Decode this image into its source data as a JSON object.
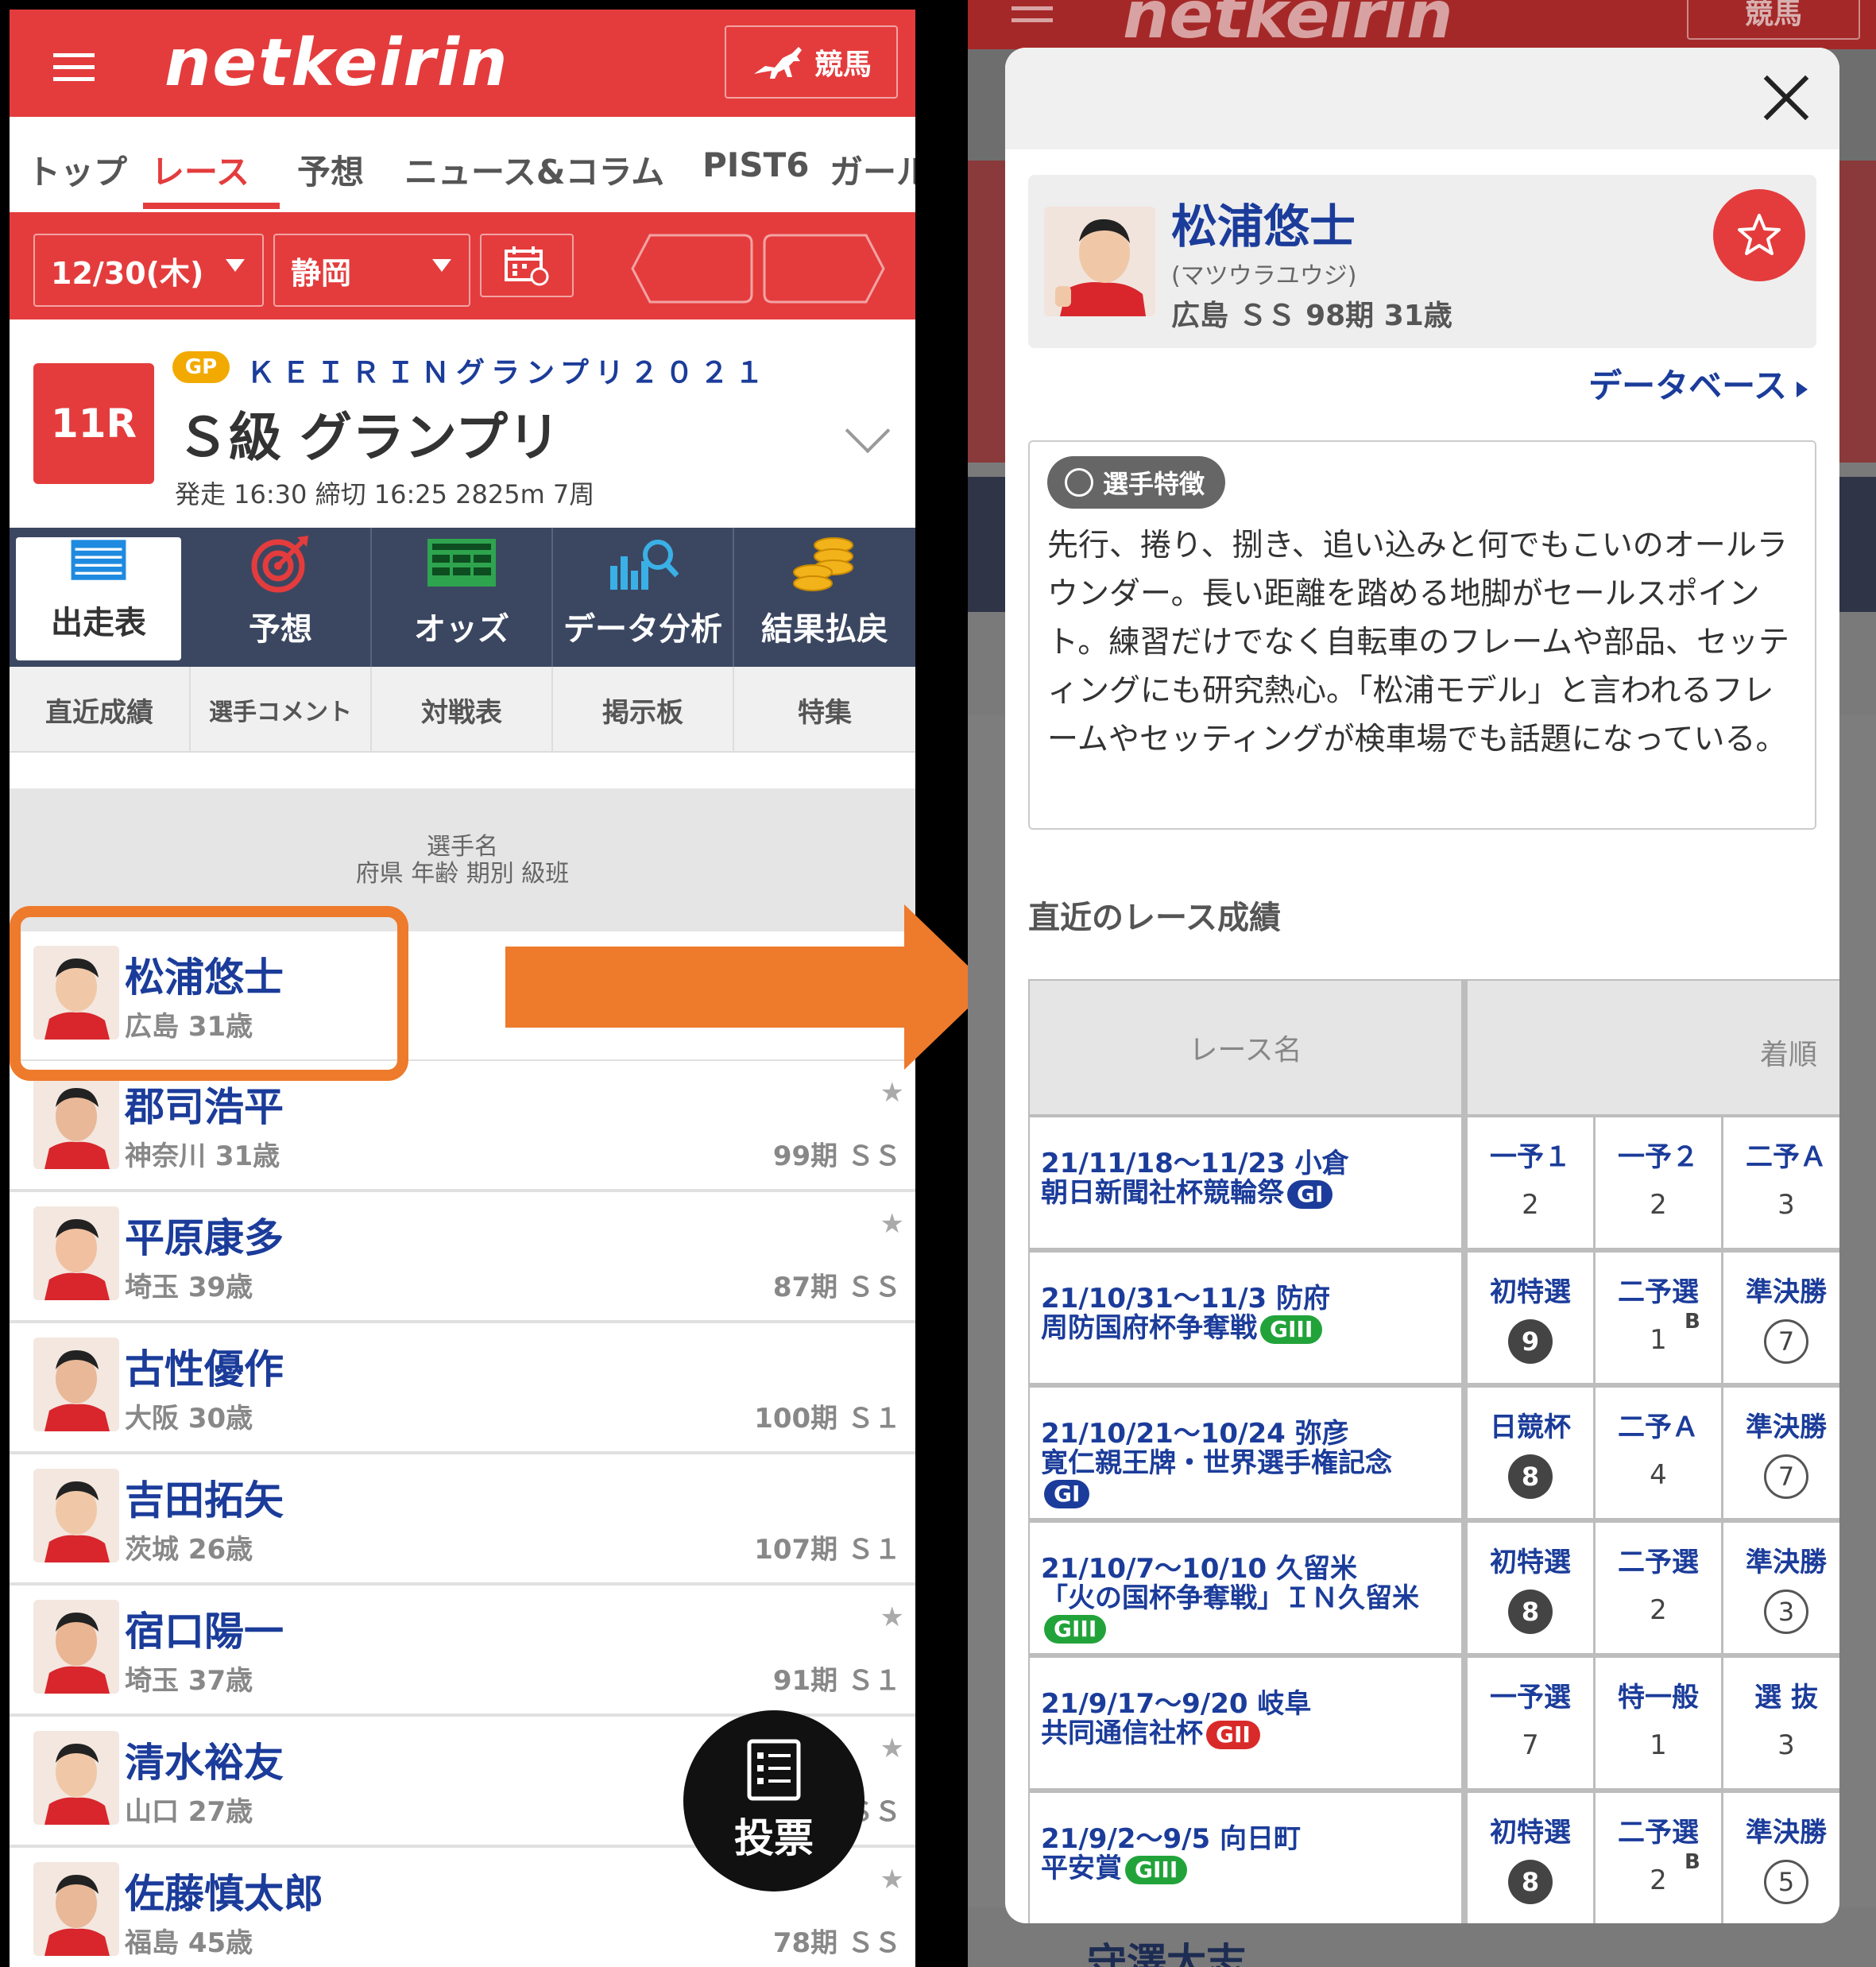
{
  "left": {
    "header": {
      "logo": "netkeirin",
      "keiba_label": "競馬"
    },
    "nav": [
      "トップ",
      "レース",
      "予想",
      "ニュース&コラム",
      "PIST6",
      "ガール"
    ],
    "selectors": {
      "date": "12/30(木)",
      "venue": "静岡"
    },
    "race": {
      "number": "11R",
      "gp_badge": "GP",
      "event_name": "ＫＥＩＲＩＮグランプリ２０２１",
      "title": "Ｓ級 グランプリ",
      "meta": "発走 16:30 締切 16:25 2825m 7周"
    },
    "tabs": [
      "出走表",
      "予想",
      "オッズ",
      "データ分析",
      "結果払戻"
    ],
    "subtabs": [
      "直近成績",
      "選手コメント",
      "対戦表",
      "掲示板",
      "特集"
    ],
    "list_header": {
      "line1": "選手名",
      "line2": "府県 年齢 期別 級班"
    },
    "riders": [
      {
        "name": "松浦悠士",
        "sub": "広島 31歳",
        "cls": "",
        "star": false
      },
      {
        "name": "郡司浩平",
        "sub": "神奈川 31歳",
        "cls": "99期 ＳＳ",
        "star": true
      },
      {
        "name": "平原康多",
        "sub": "埼玉 39歳",
        "cls": "87期 ＳＳ",
        "star": true
      },
      {
        "name": "古性優作",
        "sub": "大阪 30歳",
        "cls": "100期 Ｓ１",
        "star": false
      },
      {
        "name": "吉田拓矢",
        "sub": "茨城 26歳",
        "cls": "107期 Ｓ１",
        "star": false
      },
      {
        "name": "宿口陽一",
        "sub": "埼玉 37歳",
        "cls": "91期 Ｓ１",
        "star": true
      },
      {
        "name": "清水裕友",
        "sub": "山口 27歳",
        "cls": "ＳＳ",
        "star": true
      },
      {
        "name": "佐藤慎太郎",
        "sub": "福島 45歳",
        "cls": "78期 ＳＳ",
        "star": true
      }
    ],
    "vote_label": "投票"
  },
  "right": {
    "bg_header": {
      "logo": "netkeirin",
      "keiba_label": "競馬"
    },
    "bg_footer_name": "守澤太志",
    "profile": {
      "name": "松浦悠士",
      "kana": "(マツウラユウジ)",
      "detail": "広島 ＳＳ 98期 31歳"
    },
    "database_link": "データベース",
    "feature": {
      "tag": "選手特徴",
      "text": "先行、捲り、捌き、追い込みと何でもこいのオールラウンダー。長い距離を踏める地脚がセールスポイント。練習だけでなく自転車のフレームや部品、セッティングにも研究熱心。「松浦モデル」と言われるフレームやセッティングが検車場でも話題になっている。"
    },
    "recent_title": "直近のレース成績",
    "table": {
      "col_race": "レース名",
      "col_result": "着順",
      "rows": [
        {
          "line1": "21/11/18～11/23 小倉",
          "line2": "朝日新聞社杯競輪祭",
          "grade": "GI",
          "cells": [
            {
              "stage": "一予１",
              "pos": "2",
              "style": "plain",
              "b": ""
            },
            {
              "stage": "一予２",
              "pos": "2",
              "style": "plain",
              "b": ""
            },
            {
              "stage": "二予Ａ",
              "pos": "3",
              "style": "plain",
              "b": ""
            }
          ]
        },
        {
          "line1": "21/10/31～11/3 防府",
          "line2": "周防国府杯争奪戦",
          "grade": "GIII",
          "cells": [
            {
              "stage": "初特選",
              "pos": "9",
              "style": "filled",
              "b": ""
            },
            {
              "stage": "二予選",
              "pos": "1",
              "style": "plain",
              "b": "B"
            },
            {
              "stage": "準決勝",
              "pos": "7",
              "style": "ring",
              "b": ""
            }
          ]
        },
        {
          "line1": "21/10/21～10/24 弥彦",
          "line2": "寛仁親王牌・世界選手権記念",
          "grade": "GI",
          "cells": [
            {
              "stage": "日競杯",
              "pos": "8",
              "style": "filled",
              "b": ""
            },
            {
              "stage": "二予Ａ",
              "pos": "4",
              "style": "plain",
              "b": ""
            },
            {
              "stage": "準決勝",
              "pos": "7",
              "style": "ring",
              "b": ""
            }
          ]
        },
        {
          "line1": "21/10/7～10/10 久留米",
          "line2": "「火の国杯争奪戦」ＩＮ久留米",
          "grade": "GIII",
          "cells": [
            {
              "stage": "初特選",
              "pos": "8",
              "style": "filled",
              "b": ""
            },
            {
              "stage": "二予選",
              "pos": "2",
              "style": "plain",
              "b": ""
            },
            {
              "stage": "準決勝",
              "pos": "3",
              "style": "ring",
              "b": ""
            }
          ]
        },
        {
          "line1": "21/9/17～9/20 岐阜",
          "line2": "共同通信社杯",
          "grade": "GII",
          "cells": [
            {
              "stage": "一予選",
              "pos": "7",
              "style": "plain",
              "b": ""
            },
            {
              "stage": "特一般",
              "pos": "1",
              "style": "plain",
              "b": ""
            },
            {
              "stage": "選 抜",
              "pos": "3",
              "style": "plain",
              "b": ""
            }
          ]
        },
        {
          "line1": "21/9/2～9/5 向日町",
          "line2": "平安賞",
          "grade": "GIII",
          "cells": [
            {
              "stage": "初特選",
              "pos": "8",
              "style": "filled",
              "b": ""
            },
            {
              "stage": "二予選",
              "pos": "2",
              "style": "plain",
              "b": "B"
            },
            {
              "stage": "準決勝",
              "pos": "5",
              "style": "ring",
              "b": ""
            }
          ]
        }
      ]
    }
  },
  "colors": {
    "brand_red": "#e43c3d",
    "navy": "#1b3c9a",
    "tab_bg": "#3b4761",
    "highlight_orange": "#ee7a2c",
    "gi": "#1b3c9a",
    "gii": "#d92a2a",
    "giii": "#22a33a"
  }
}
